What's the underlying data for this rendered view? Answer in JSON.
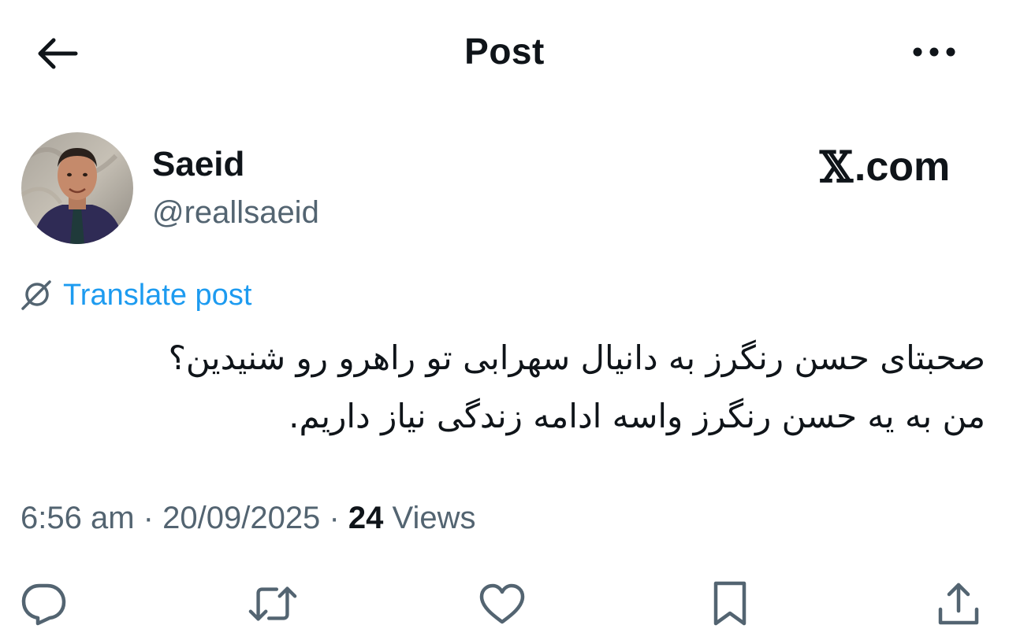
{
  "header": {
    "title": "Post",
    "back_icon": "arrow-left-icon",
    "more_icon": "more-horizontal-icon"
  },
  "author": {
    "display_name": "Saeid",
    "handle": "@reallsaeid"
  },
  "watermark": {
    "x_mark": "𝕏",
    "domain": ".com"
  },
  "translate": {
    "label": "Translate post",
    "icon": "globe-icon"
  },
  "tweet": {
    "lines": [
      "صحبتای حسن رنگرز به دانیال سهرابی تو راهرو رو شنیدین؟",
      "من به یه حسن رنگرز واسه ادامه زندگی نیاز داریم."
    ]
  },
  "meta": {
    "time": "6:56 am",
    "separator": "·",
    "date": "20/09/2025",
    "views_count": "24",
    "views_label": "Views"
  },
  "actions": [
    {
      "name": "reply",
      "icon": "reply-icon"
    },
    {
      "name": "repost",
      "icon": "repost-icon"
    },
    {
      "name": "like",
      "icon": "heart-icon"
    },
    {
      "name": "bookmark",
      "icon": "bookmark-icon"
    },
    {
      "name": "share",
      "icon": "share-icon"
    }
  ],
  "colors": {
    "text": "#0f1419",
    "secondary": "#536471",
    "accent": "#1d9bf0",
    "background": "#ffffff"
  }
}
